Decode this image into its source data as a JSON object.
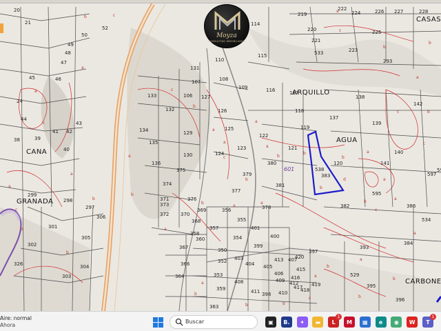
{
  "map": {
    "place_names": {
      "arquillo": "ARQUILLO",
      "agua": "AGUA",
      "cana": "CANA",
      "granada": "GRANADA",
      "carbonera": "CARBONER",
      "casas": "CASAS"
    },
    "polygon_label": "601",
    "parcels": [
      "20",
      "21",
      "50",
      "52",
      "49",
      "48",
      "47",
      "46",
      "45",
      "43",
      "44",
      "41",
      "42",
      "40",
      "39",
      "38",
      "24",
      "114",
      "110",
      "115",
      "116",
      "117",
      "118",
      "119",
      "120",
      "121",
      "122",
      "123",
      "124",
      "125",
      "126",
      "127",
      "129",
      "130",
      "131",
      "132",
      "133",
      "134",
      "135",
      "136",
      "137",
      "138",
      "139",
      "140",
      "141",
      "142",
      "219",
      "220",
      "221",
      "222",
      "223",
      "224",
      "225",
      "226",
      "227",
      "228",
      "293",
      "374",
      "375",
      "376",
      "377",
      "378",
      "379",
      "380",
      "381",
      "382",
      "383",
      "384",
      "386",
      "393",
      "395",
      "396",
      "397",
      "398",
      "399",
      "400",
      "401",
      "403",
      "404",
      "405",
      "406",
      "407",
      "408",
      "409",
      "410",
      "411",
      "412",
      "413",
      "415",
      "416",
      "417",
      "418",
      "419",
      "420",
      "529",
      "533",
      "538",
      "297",
      "298",
      "299",
      "301",
      "302",
      "303",
      "304",
      "305",
      "306",
      "326",
      "350",
      "352",
      "353",
      "354",
      "355",
      "356",
      "357",
      "358",
      "359",
      "360",
      "363",
      "364",
      "366",
      "367",
      "368",
      "369",
      "370",
      "371",
      "372",
      "373",
      "534",
      "595",
      "597",
      "598",
      "107",
      "108",
      "109",
      "106"
    ],
    "letters": [
      "a",
      "b",
      "c",
      "d"
    ],
    "highlight_color": "#1c1cc8",
    "contour_color": "#d02a2a",
    "road_color": "#e8a567"
  },
  "logo": {
    "name": "Moyza",
    "tagline": "CONSULTING INMOBILIARIO"
  },
  "taskbar": {
    "weather_line1": "Aire: normal",
    "weather_line2": "Ahora",
    "search_placeholder": "Buscar",
    "apps": [
      {
        "name": "task-view",
        "color": "#222",
        "glyph": "▣"
      },
      {
        "name": "booking-app",
        "color": "#1e3a8a",
        "glyph": "B."
      },
      {
        "name": "copilot-app",
        "color": "#8b5cf6",
        "glyph": "✦"
      },
      {
        "name": "file-explorer",
        "color": "#f2b632",
        "glyph": "▬"
      },
      {
        "name": "mail-app",
        "color": "#c22",
        "glyph": "L",
        "badge": "1"
      },
      {
        "name": "mcafee-app",
        "color": "#c8102e",
        "glyph": "M"
      },
      {
        "name": "store-app",
        "color": "#2c6fd1",
        "glyph": "▦"
      },
      {
        "name": "edge-browser",
        "color": "#0f8a8a",
        "glyph": "e"
      },
      {
        "name": "maps-app",
        "color": "#4a7",
        "glyph": "◉"
      },
      {
        "name": "wps-app",
        "color": "#d22",
        "glyph": "W"
      },
      {
        "name": "teams-app",
        "color": "#5b5fc7",
        "glyph": "T",
        "badge": "1"
      }
    ]
  }
}
